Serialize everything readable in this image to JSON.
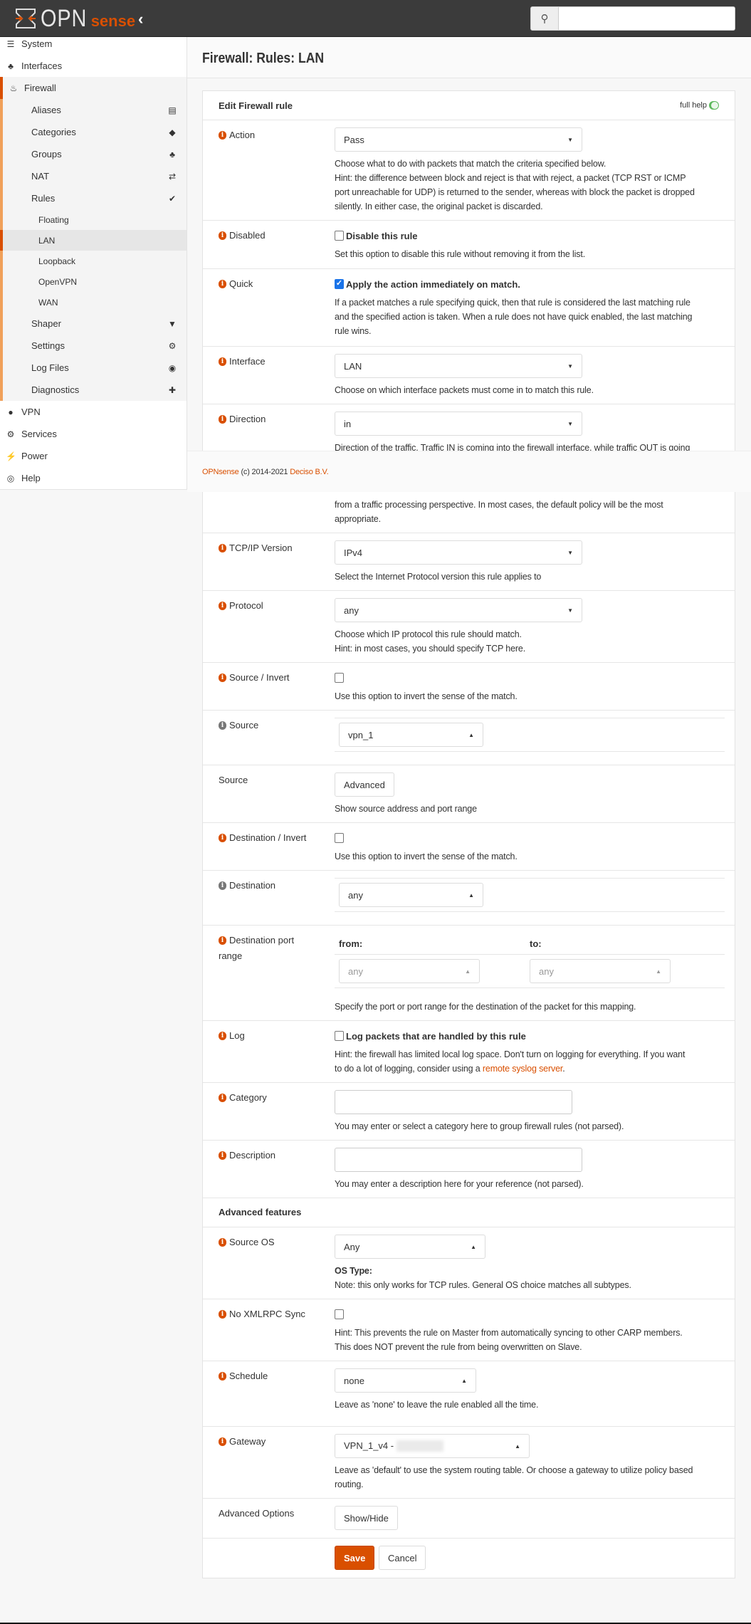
{
  "topbar": {
    "brand_opn": "OPN",
    "brand_sense": "sense",
    "search_value": ""
  },
  "sidebar": {
    "top": [
      {
        "label": "System",
        "icon": "server-icon"
      },
      {
        "label": "Interfaces",
        "icon": "sitemap-icon"
      }
    ],
    "firewall": {
      "label": "Firewall",
      "icon": "fire-icon",
      "items": [
        {
          "label": "Aliases",
          "icon": "list-icon"
        },
        {
          "label": "Categories",
          "icon": "tags-icon"
        },
        {
          "label": "Groups",
          "icon": "sitemap-icon"
        },
        {
          "label": "NAT",
          "icon": "exchange-icon"
        },
        {
          "label": "Rules",
          "icon": "check-icon"
        }
      ],
      "rules": [
        "Floating",
        "LAN",
        "Loopback",
        "OpenVPN",
        "WAN"
      ],
      "active_rule": "LAN",
      "more": [
        {
          "label": "Shaper",
          "icon": "filter-icon"
        },
        {
          "label": "Settings",
          "icon": "cogs-icon"
        },
        {
          "label": "Log Files",
          "icon": "eye-icon"
        },
        {
          "label": "Diagnostics",
          "icon": "medkit-icon"
        }
      ]
    },
    "bottom": [
      {
        "label": "VPN",
        "icon": "globe-icon"
      },
      {
        "label": "Services",
        "icon": "cog-icon"
      },
      {
        "label": "Power",
        "icon": "plug-icon"
      },
      {
        "label": "Help",
        "icon": "life-ring-icon"
      }
    ]
  },
  "page": {
    "title": "Firewall: Rules: LAN"
  },
  "footer": {
    "brand": "OPNsense",
    "copyright": " (c) 2014-2021 ",
    "company": "Deciso B.V."
  },
  "card": {
    "title": "Edit Firewall rule",
    "full_help": "full help",
    "full_help_on": true
  },
  "form": {
    "action": {
      "label": "Action",
      "value": "Pass",
      "help": [
        "Choose what to do with packets that match the criteria specified below.",
        "Hint: the difference between block and reject is that with reject, a packet (TCP RST or ICMP",
        "port unreachable for UDP) is returned to the sender, whereas with block the packet is dropped",
        "silently. In either case, the original packet is discarded."
      ]
    },
    "disabled": {
      "label": "Disabled",
      "checked": false,
      "check_label": "Disable this rule",
      "help": [
        "Set this option to disable this rule without removing it from the list."
      ]
    },
    "quick": {
      "label": "Quick",
      "checked": true,
      "check_label": "Apply the action immediately on match.",
      "help": [
        "If a packet matches a rule specifying quick, then that rule is considered the last matching rule",
        "and the specified action is taken. When a rule does not have quick enabled, the last matching",
        "rule wins."
      ]
    },
    "interface": {
      "label": "Interface",
      "value": "LAN",
      "help": [
        "Choose on which interface packets must come in to match this rule."
      ]
    },
    "direction": {
      "label": "Direction",
      "value": "in",
      "help": [
        "Direction of the traffic. Traffic IN is coming into the firewall interface, while traffic OUT is going",
        "from a traffic processing perspective. In most cases, the default policy will be the most",
        "appropriate."
      ]
    },
    "ipversion": {
      "label": "TCP/IP Version",
      "value": "IPv4",
      "help": [
        "Select the Internet Protocol version this rule applies to"
      ]
    },
    "protocol": {
      "label": "Protocol",
      "value": "any",
      "help": [
        "Choose which IP protocol this rule should match.",
        "Hint: in most cases, you should specify TCP here."
      ]
    },
    "source_invert": {
      "label": "Source / Invert",
      "checked": false,
      "help": [
        "Use this option to invert the sense of the match."
      ]
    },
    "source": {
      "label": "Source",
      "value": "vpn_1"
    },
    "source_adv": {
      "label": "Source",
      "button": "Advanced",
      "help": [
        "Show source address and port range"
      ]
    },
    "dest_invert": {
      "label": "Destination / Invert",
      "checked": false,
      "help": [
        "Use this option to invert the sense of the match."
      ]
    },
    "destination": {
      "label": "Destination",
      "value": "any"
    },
    "dest_port": {
      "label": "Destination port",
      "label2": "range",
      "from_label": "from:",
      "to_label": "to:",
      "from_value": "any",
      "to_value": "any",
      "help": [
        "Specify the port or port range for the destination of the packet for this mapping."
      ]
    },
    "log": {
      "label": "Log",
      "checked": false,
      "check_label": "Log packets that are handled by this rule",
      "help1": "Hint: the firewall has limited local log space. Don't turn on logging for everything. If you want",
      "help2": "to do a lot of logging, consider using a ",
      "link": "remote syslog server",
      "help3": "."
    },
    "category": {
      "label": "Category",
      "value": "",
      "help": [
        "You may enter or select a category here to group firewall rules (not parsed)."
      ]
    },
    "description": {
      "label": "Description",
      "value": "",
      "help": [
        "You may enter a description here for your reference (not parsed)."
      ]
    },
    "advanced_features": "Advanced features",
    "source_os": {
      "label": "Source OS",
      "value": "Any",
      "type_label": "OS Type:",
      "help": [
        "Note: this only works for TCP rules. General OS choice matches all subtypes."
      ]
    },
    "xmlrpc": {
      "label": "No XMLRPC Sync",
      "checked": false,
      "help": [
        "Hint: This prevents the rule on Master from automatically syncing to other CARP members.",
        "This does NOT prevent the rule from being overwritten on Slave."
      ]
    },
    "schedule": {
      "label": "Schedule",
      "value": "none",
      "help": [
        "Leave as 'none' to leave the rule enabled all the time."
      ]
    },
    "gateway": {
      "label": "Gateway",
      "value": "VPN_1_v4 -",
      "help": [
        "Leave as 'default' to use the system routing table. Or choose a gateway to utilize policy based",
        "routing."
      ]
    },
    "advanced_options": {
      "label": "Advanced Options",
      "button": "Show/Hide"
    },
    "save": "Save",
    "cancel": "Cancel"
  },
  "colors": {
    "accent": "#d94f00",
    "topbar": "#3b3b3b",
    "checkbox": "#1a73e8",
    "toggle": "#5cb85c"
  }
}
